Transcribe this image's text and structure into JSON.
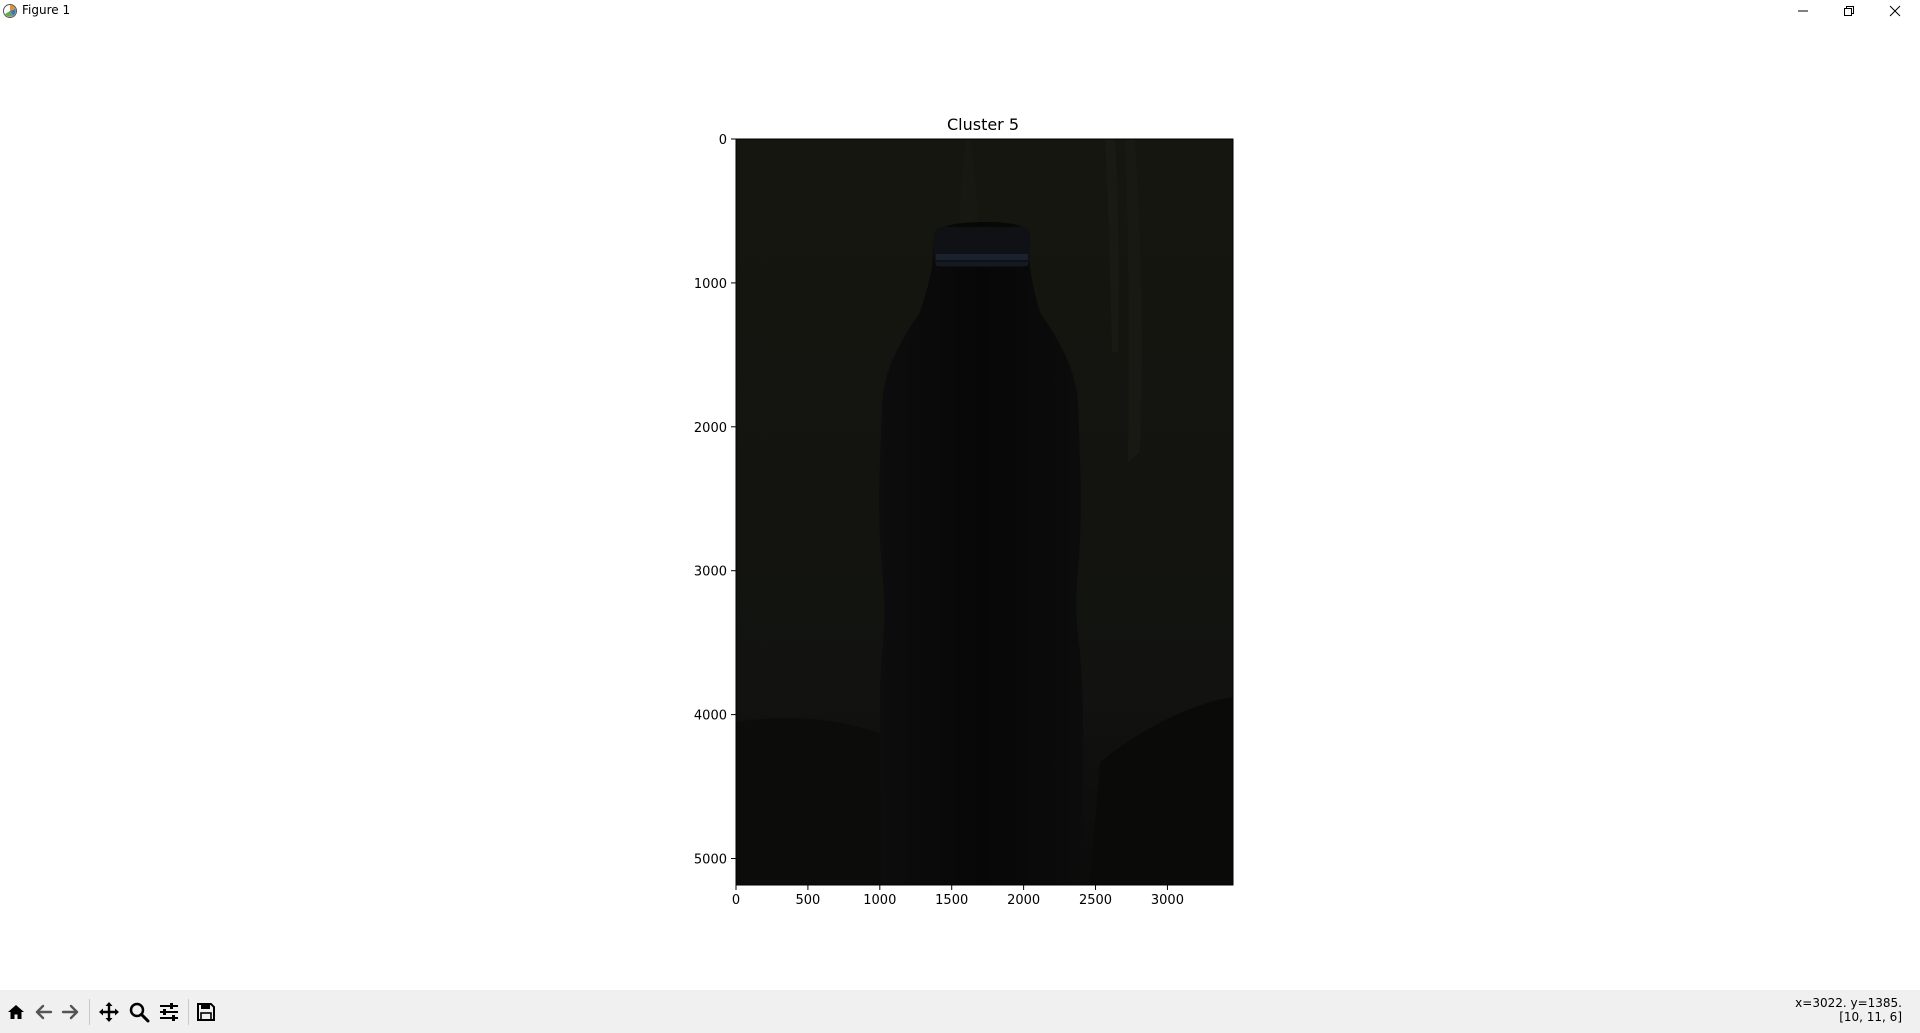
{
  "window": {
    "title": "Figure 1",
    "icons": {
      "app": "matplotlib-icon",
      "minimize": "minimize-icon",
      "maximize": "restore-icon",
      "close": "close-icon"
    }
  },
  "figure": {
    "title": "Cluster 5",
    "image_description_colors": {
      "background": "#151610",
      "bottle": "#080808",
      "cap_highlight": "#1d2230"
    }
  },
  "chart_data": {
    "type": "image",
    "title": "Cluster 5",
    "xlabel": "",
    "ylabel": "",
    "xlim": [
      0,
      3456
    ],
    "ylim": [
      5184,
      0
    ],
    "x_ticks": [
      0,
      500,
      1000,
      1500,
      2000,
      2500,
      3000
    ],
    "y_ticks": [
      0,
      1000,
      2000,
      3000,
      4000,
      5000
    ],
    "x_tick_labels": [
      "0",
      "500",
      "1000",
      "1500",
      "2000",
      "2500",
      "3000"
    ],
    "y_tick_labels": [
      "0",
      "1000",
      "2000",
      "3000",
      "4000",
      "5000"
    ],
    "grid": false
  },
  "toolbar": {
    "buttons": [
      {
        "name": "home-button",
        "icon": "home-icon"
      },
      {
        "name": "back-button",
        "icon": "arrow-left-icon"
      },
      {
        "name": "forward-button",
        "icon": "arrow-right-icon"
      },
      {
        "name": "pan-button",
        "icon": "move-icon"
      },
      {
        "name": "zoom-button",
        "icon": "magnifier-icon"
      },
      {
        "name": "configure-subplots-button",
        "icon": "sliders-icon"
      },
      {
        "name": "save-button",
        "icon": "floppy-disk-icon"
      }
    ],
    "coords_line1": "x=3022. y=1385.",
    "coords_line2": "[10, 11, 6]"
  }
}
